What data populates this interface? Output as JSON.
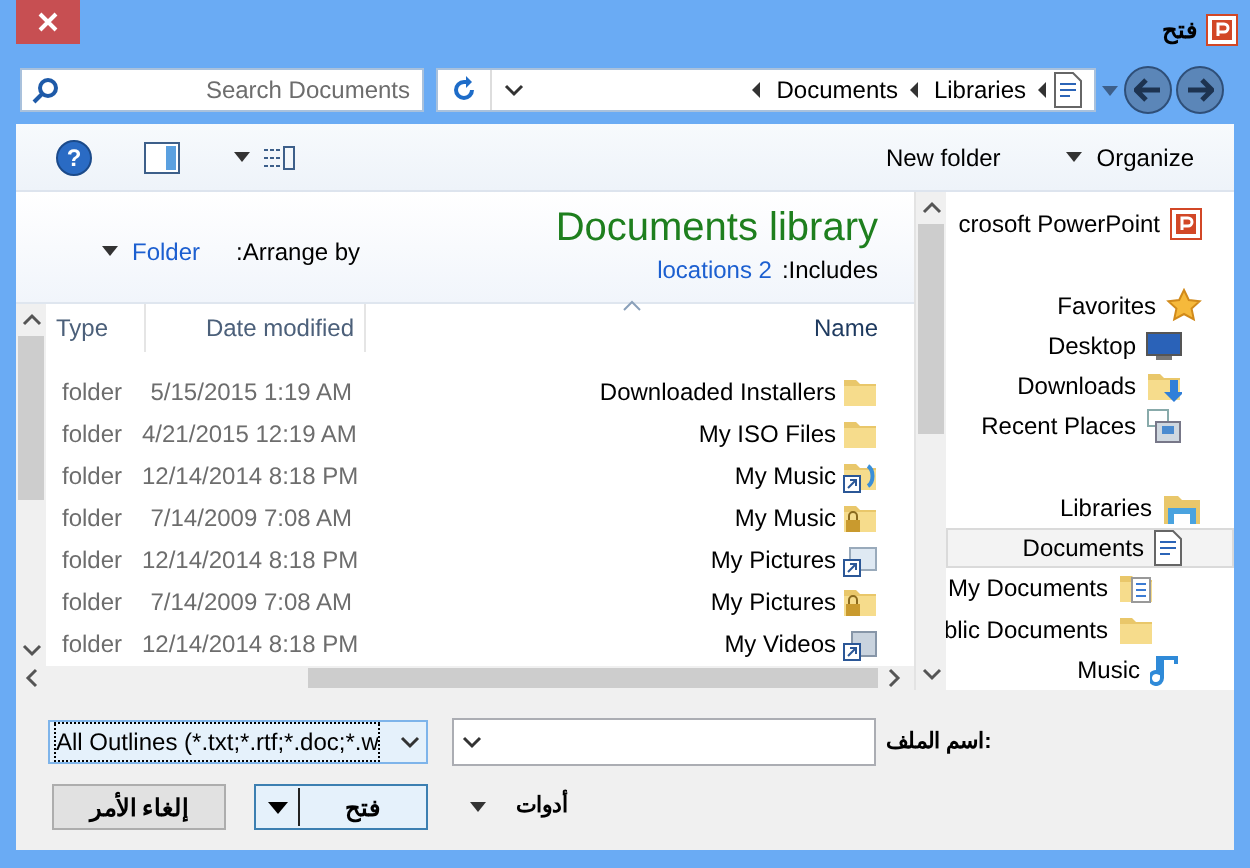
{
  "window": {
    "title": "فتح"
  },
  "search": {
    "placeholder": "Search Documents"
  },
  "address": {
    "breadcrumbs": [
      "Documents",
      "Libraries"
    ]
  },
  "toolbar": {
    "help": "?",
    "buttons": [
      {
        "label": "New folder",
        "kind": "plain"
      },
      {
        "label": "Organize",
        "kind": "menu"
      }
    ]
  },
  "library": {
    "title": "Documents library",
    "includes_label": ":Includes",
    "includes_link": "locations 2",
    "arrange_label": ":Arrange by",
    "arrange_value": "Folder"
  },
  "file_list": {
    "columns": [
      {
        "label": "Type",
        "sorted": false
      },
      {
        "label": "Date modified",
        "sorted": false
      },
      {
        "label": "Name",
        "sorted": true
      }
    ],
    "rows": [
      {
        "name": "Downloaded Installers",
        "date": "5/15/2015 1:19 AM",
        "type": "folder",
        "kind": "folder"
      },
      {
        "name": "My ISO Files",
        "date": "4/21/2015 12:19 AM",
        "type": "folder",
        "kind": "folder"
      },
      {
        "name": "My Music",
        "date": "12/14/2014 8:18 PM",
        "type": "folder",
        "kind": "music-shortcut"
      },
      {
        "name": "My Music",
        "date": "7/14/2009 7:08 AM",
        "type": "folder",
        "kind": "locked"
      },
      {
        "name": "My Pictures",
        "date": "12/14/2014 8:18 PM",
        "type": "folder",
        "kind": "pictures-shortcut"
      },
      {
        "name": "My Pictures",
        "date": "7/14/2009 7:08 AM",
        "type": "folder",
        "kind": "locked"
      },
      {
        "name": "My Videos",
        "date": "12/14/2014 8:18 PM",
        "type": "folder",
        "kind": "videos-shortcut"
      }
    ]
  },
  "nav_pane": {
    "items": [
      {
        "label": "crosoft PowerPoint",
        "kind": "app",
        "selected": false
      },
      {
        "label": "Favorites",
        "kind": "star",
        "selected": false,
        "children": [
          {
            "label": "Desktop",
            "kind": "desktop",
            "selected": false
          },
          {
            "label": "Downloads",
            "kind": "downloads",
            "selected": false
          },
          {
            "label": "Recent Places",
            "kind": "recent",
            "selected": false
          }
        ]
      },
      {
        "label": "Libraries",
        "kind": "libraries",
        "selected": false,
        "children": [
          {
            "label": "Documents",
            "kind": "documents",
            "selected": true,
            "children": [
              {
                "label": "My Documents",
                "kind": "docfolder",
                "selected": false
              },
              {
                "label": "blic Documents",
                "kind": "folder",
                "selected": false
              }
            ]
          },
          {
            "label": "Music",
            "kind": "music",
            "selected": false
          }
        ]
      }
    ]
  },
  "file_name": {
    "label": "اسم الملف:"
  },
  "file_type": {
    "value": "All Outlines (*.txt;*.rtf;*.doc;*.w"
  },
  "tools": {
    "label": "أدوات"
  },
  "buttons": [
    {
      "label": "فتح",
      "kind": "split",
      "default": true
    },
    {
      "label": "إلغاء الأمر",
      "kind": "plain",
      "default": false
    }
  ]
}
